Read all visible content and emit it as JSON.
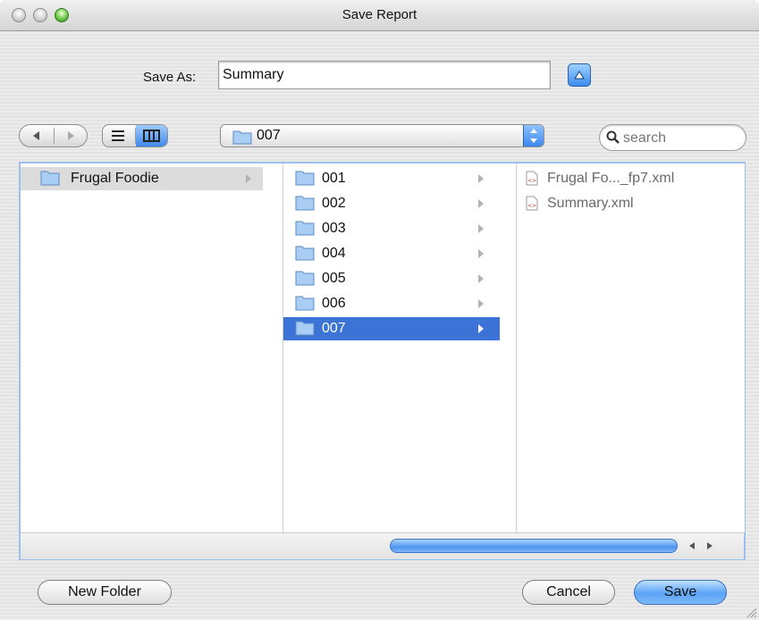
{
  "window": {
    "title": "Save Report"
  },
  "save_as": {
    "label": "Save As:",
    "value": "Summary"
  },
  "toolbar": {
    "view_list_icon": "list-view-icon",
    "view_columns_icon": "column-view-icon",
    "location": "007",
    "search_placeholder": "search"
  },
  "columns": {
    "col1": [
      {
        "label": "Frugal Foodie"
      }
    ],
    "col2": [
      {
        "label": "001"
      },
      {
        "label": "002"
      },
      {
        "label": "003"
      },
      {
        "label": "004"
      },
      {
        "label": "005"
      },
      {
        "label": "006"
      },
      {
        "label": "007"
      }
    ],
    "col3": [
      {
        "label": "Frugal Fo..._fp7.xml"
      },
      {
        "label": "Summary.xml"
      }
    ]
  },
  "buttons": {
    "new_folder": "New Folder",
    "cancel": "Cancel",
    "save": "Save"
  },
  "colors": {
    "selection": "#3b74d6",
    "accent": "#5aa3f5"
  }
}
